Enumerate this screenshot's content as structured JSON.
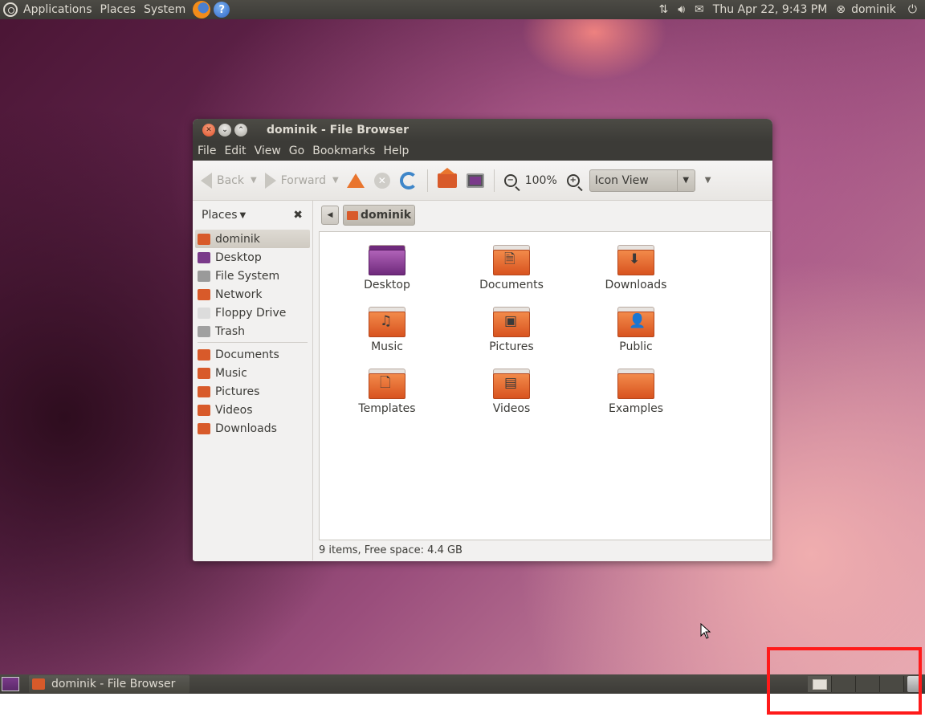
{
  "top_panel": {
    "menus": [
      "Applications",
      "Places",
      "System"
    ],
    "clock": "Thu Apr 22,  9:43 PM",
    "user": "dominik"
  },
  "window": {
    "title": "dominik - File Browser",
    "menu": [
      "File",
      "Edit",
      "View",
      "Go",
      "Bookmarks",
      "Help"
    ],
    "toolbar": {
      "back_label": "Back",
      "forward_label": "Forward",
      "zoom_level": "100%",
      "view_mode": "Icon View"
    },
    "sidebar": {
      "header": "Places",
      "items": [
        {
          "label": "dominik",
          "icon": "home-folder-icon",
          "color": "#d85a2a",
          "selected": true
        },
        {
          "label": "Desktop",
          "icon": "desktop-icon",
          "color": "#7a3a8a"
        },
        {
          "label": "File System",
          "icon": "harddisk-icon",
          "color": "#9a9a9a"
        },
        {
          "label": "Network",
          "icon": "network-icon",
          "color": "#d85a2a"
        },
        {
          "label": "Floppy Drive",
          "icon": "floppy-icon",
          "color": "#dcdcdc"
        },
        {
          "label": "Trash",
          "icon": "trash-icon",
          "color": "#a0a0a0"
        }
      ],
      "bookmarks": [
        {
          "label": "Documents",
          "icon": "documents-folder-icon",
          "color": "#d85a2a"
        },
        {
          "label": "Music",
          "icon": "music-folder-icon",
          "color": "#d85a2a"
        },
        {
          "label": "Pictures",
          "icon": "pictures-folder-icon",
          "color": "#d85a2a"
        },
        {
          "label": "Videos",
          "icon": "videos-folder-icon",
          "color": "#d85a2a"
        },
        {
          "label": "Downloads",
          "icon": "downloads-folder-icon",
          "color": "#d85a2a"
        }
      ]
    },
    "path": {
      "crumb": "dominik"
    },
    "files": [
      {
        "label": "Desktop",
        "icon": "desktop-folder-icon",
        "emblem": ""
      },
      {
        "label": "Documents",
        "icon": "documents-folder-icon",
        "emblem": "🗎"
      },
      {
        "label": "Downloads",
        "icon": "downloads-folder-icon",
        "emblem": "⬇"
      },
      {
        "label": "Music",
        "icon": "music-folder-icon",
        "emblem": "♫"
      },
      {
        "label": "Pictures",
        "icon": "pictures-folder-icon",
        "emblem": "▣"
      },
      {
        "label": "Public",
        "icon": "public-folder-icon",
        "emblem": "👤"
      },
      {
        "label": "Templates",
        "icon": "templates-folder-icon",
        "emblem": "🗋"
      },
      {
        "label": "Videos",
        "icon": "videos-folder-icon",
        "emblem": "▤"
      },
      {
        "label": "Examples",
        "icon": "examples-folder-icon",
        "emblem": ""
      }
    ],
    "status": "9 items, Free space: 4.4 GB"
  },
  "bottom_panel": {
    "task_label": "dominik - File Browser",
    "workspace_count": 4,
    "active_workspace": 1
  },
  "colors": {
    "panel": "#3c3b37",
    "accent_orange": "#e9752e",
    "highlight": "#ff1a1a"
  }
}
